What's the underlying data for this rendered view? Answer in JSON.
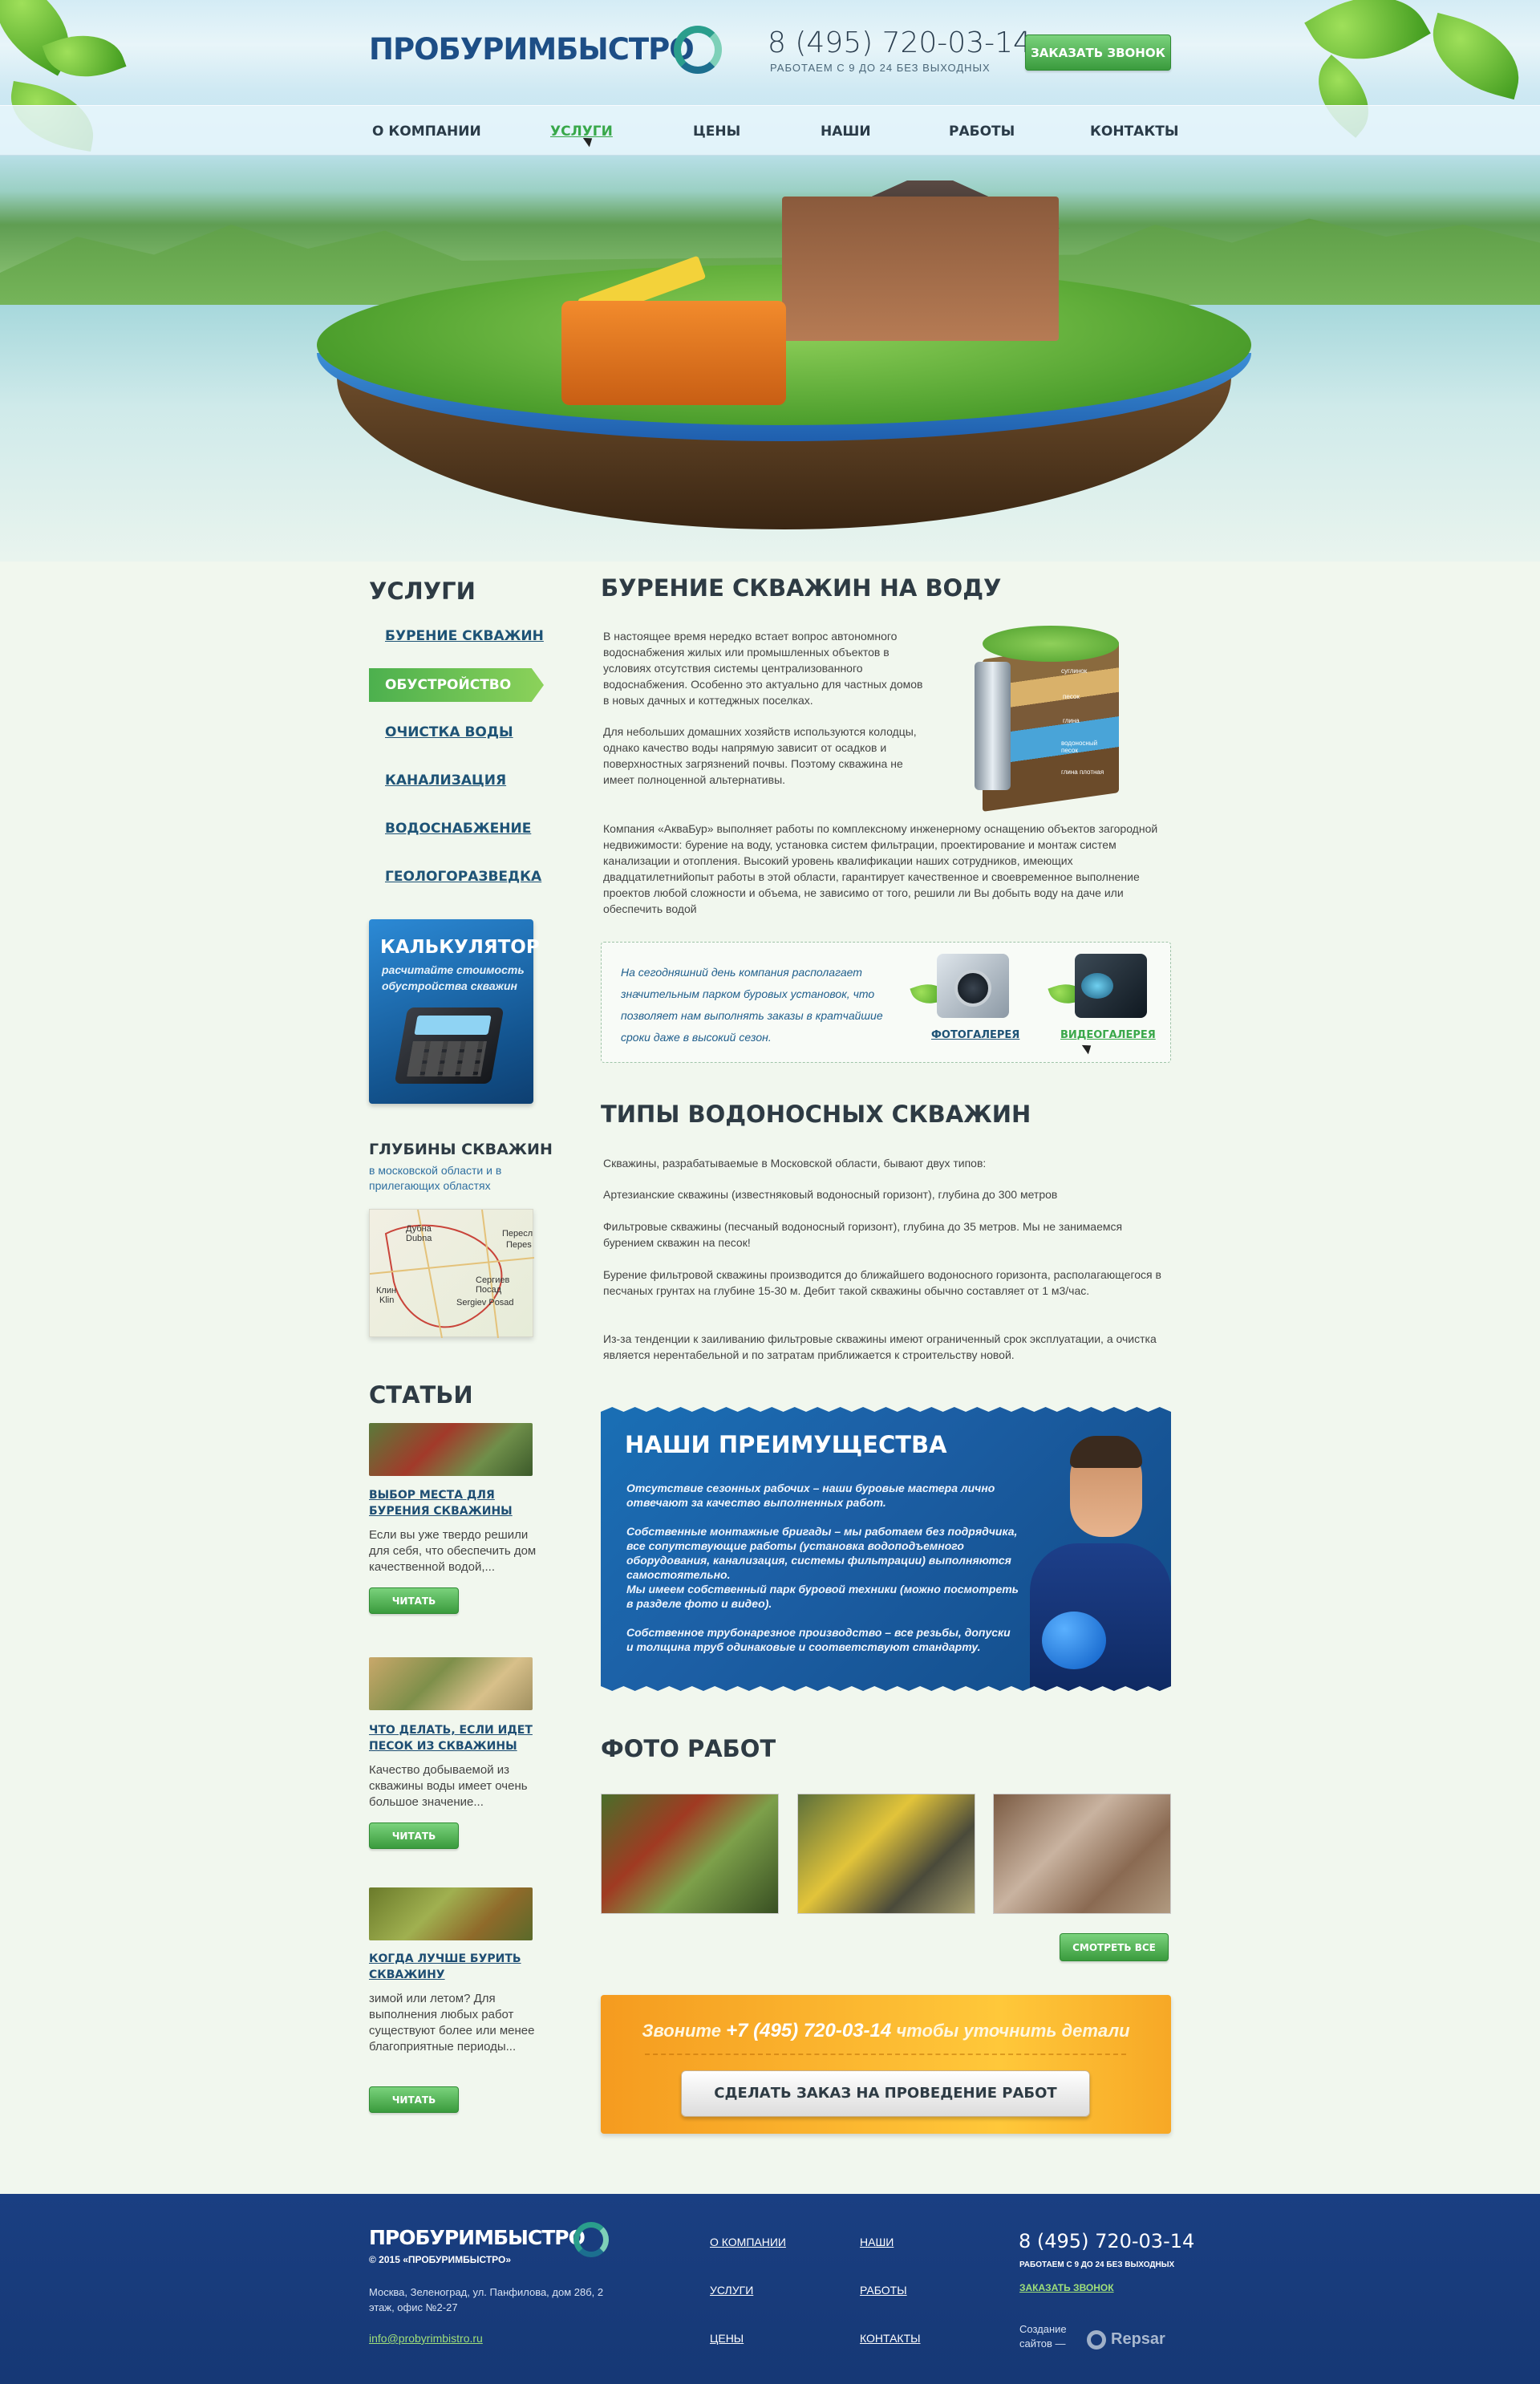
{
  "header": {
    "logo": "ПРОБУРИМБЫСТРО",
    "phone": "8 (495) 720-03-14",
    "worktime": "РАБОТАЕМ С 9 ДО 24 БЕЗ ВЫХОДНЫХ",
    "callback_button": "ЗАКАЗАТЬ ЗВОНОК"
  },
  "nav": {
    "items": [
      "О КОМПАНИИ",
      "УСЛУГИ",
      "ЦЕНЫ",
      "НАШИ",
      "РАБОТЫ",
      "КОНТАКТЫ"
    ],
    "active_color": "#38a84a"
  },
  "sidebar": {
    "services_title": "УСЛУГИ",
    "links": [
      "БУРЕНИЕ СКВАЖИН",
      "ОБУСТРОЙСТВО",
      "ОЧИСТКА ВОДЫ",
      "КАНАЛИЗАЦИЯ",
      "ВОДОСНАБЖЕНИЕ",
      "ГЕОЛОГОРАЗВЕДКА"
    ],
    "calculator": {
      "title": "КАЛЬКУЛЯТОР",
      "subtitle": "расчитайте стоимость обустройства скважин"
    },
    "depth": {
      "title": "ГЛУБИНЫ СКВАЖИН",
      "subtitle": "в московской области и в прилегающих областях"
    },
    "map_labels": [
      "Дубна",
      "Dubna",
      "Пересл",
      "Переs",
      "Клин",
      "Klin",
      "Сергиев Посад",
      "Sergiev Posad"
    ],
    "articles_title": "СТАТЬИ",
    "articles": [
      {
        "title": "ВЫБОР МЕСТА ДЛЯ БУРЕНИЯ СКВАЖИНЫ",
        "text": "Если вы уже твердо решили для себя, что обеспечить дом качественной водой,...",
        "button": "ЧИТАТЬ"
      },
      {
        "title": "ЧТО ДЕЛАТЬ, ЕСЛИ ИДЕТ ПЕСОК ИЗ СКВАЖИНЫ",
        "text": "Качество добываемой из скважины воды имеет очень большое значение...",
        "button": "ЧИТАТЬ"
      },
      {
        "title": "КОГДА ЛУЧШЕ БУРИТЬ СКВАЖИНУ",
        "text": " зимой или летом? Для выполнения любых работ существуют более или менее благоприятные периоды...",
        "button": "ЧИТАТЬ"
      }
    ]
  },
  "main": {
    "title": "БУРЕНИЕ СКВАЖИН НА ВОДУ",
    "p1": "В настоящее время нередко встает вопрос автономного водоснабжения жилых или промышленных объектов в условиях отсутствия системы централизованного водоснабжения. Особенно это актуально для частных домов в новых дачных и коттеджных поселках.",
    "p2": "Для небольших домашних хозяйств используются колодцы, однако качество воды напрямую зависит от осадков и поверхностных загрязнений почвы. Поэтому скважина не имеет полноценной альтернативы.",
    "p3": "Компания «АкваБур» выполняет работы по комплексному инженерному оснащению объектов загородной недвижимости: бурение на воду, установка систем фильтрации, проектирование и монтаж систем канализации и отопления. Высокий уровень квалификации наших сотрудников, имеющих двадцатилетнийопыт работы в этой области, гарантирует качественное и своевременное выполнение проектов любой сложности и объема, не зависимо от того, решили ли Вы добыть воду на даче или обеспечить водой",
    "well_labels": [
      "суглинок",
      "песок",
      "глина",
      "водоносный песок",
      "глина плотная"
    ],
    "gallery_text": "На сегодняшний день компания располагает значительным парком буровых установок, что позволяет нам выполнять заказы в кратчайшие сроки даже в высокий сезон.",
    "photo_gallery": "ФОТОГАЛЕРЕЯ",
    "video_gallery": "ВИДЕОГАЛЕРЕЯ",
    "types_title": "ТИПЫ ВОДОНОСНЫХ СКВАЖИН",
    "types_p1": "Скважины, разрабатываемые в Московской области, бывают двух типов:",
    "types_p2": "Артезианские скважины (известняковый водоносный горизонт), глубина до 300 метров",
    "types_p3": "Фильтровые скважины (песчаный водоносный горизонт), глубина до 35 метров. Мы не занимаемся бурением скважин на песок!",
    "types_p4": "Бурение фильтровой скважины производится до ближайшего водоносного горизонта, располагающегося в песчаных грунтах на глубине 15-30 м. Дебит такой скважины обычно составляет от 1 м3/час.",
    "types_p5": "Из-за тенденции к заиливанию фильтровые скважины имеют ограниченный срок эксплуатации, а очистка является нерентабельной и по затратам приближается к строительству новой.",
    "advantages_title": "НАШИ ПРЕИМУЩЕСТВА",
    "advantages": [
      "Отсутствие сезонных рабочих – наши буровые мастера лично отвечают за качество выполненных работ.",
      "Собственные монтажные бригады – мы работаем без подрядчика, все сопутствующие работы (установка водоподъемного оборудования, канализация, системы фильтрации) выполняются самостоятельно.",
      "Мы имеем собственный парк буровой техники (можно посмотреть в разделе фото и видео).",
      "Собственное трубонарезное производство – все резьбы, допуски и толщина труб одинаковые и соответствуют стандарту."
    ],
    "photos_title": "ФОТО РАБОТ",
    "see_all": "СМОТРЕТЬ ВСЕ",
    "order": {
      "line_before": "Звоните",
      "phone": "+7 (495) 720-03-14",
      "line_after": "чтобы уточнить детали",
      "button": "СДЕЛАТЬ ЗАКАЗ НА ПРОВЕДЕНИЕ РАБОТ"
    }
  },
  "footer": {
    "logo": "ПРОБУРИМБЫСТРО",
    "copyright": "© 2015 «ПРОБУРИМБЫСТРО»",
    "address": "Москва, Зеленоград, ул. Панфилова, дом 28б, 2 этаж, офис №2-27",
    "email": "info@probyrimbistro.ru",
    "links_col1": [
      "О КОМПАНИИ",
      "УСЛУГИ",
      "ЦЕНЫ"
    ],
    "links_col2": [
      "НАШИ",
      "РАБОТЫ",
      "КОНТАКТЫ"
    ],
    "phone": "8 (495) 720-03-14",
    "worktime": "РАБОТАЕМ С 9 ДО 24 БЕЗ ВЫХОДНЫХ",
    "callback": "ЗАКАЗАТЬ ЗВОНОК",
    "credit": "Создание сайтов —",
    "credit_brand": "Repsar"
  }
}
